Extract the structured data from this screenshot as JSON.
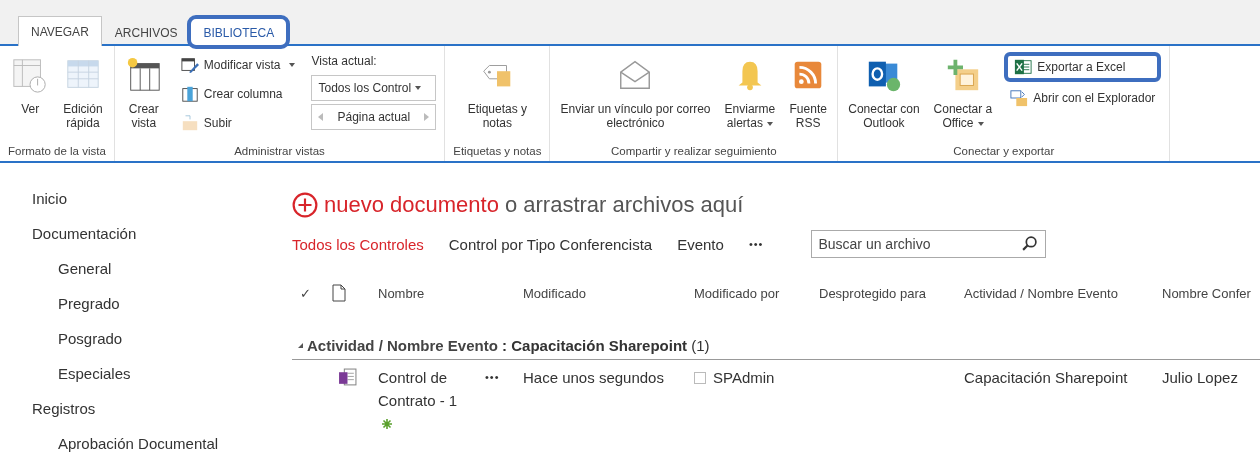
{
  "tabs": [
    {
      "label": "NAVEGAR",
      "selected": true,
      "highlighted": false
    },
    {
      "label": "ARCHIVOS",
      "selected": false,
      "highlighted": false
    },
    {
      "label": "BIBLIOTECA",
      "selected": false,
      "highlighted": true
    }
  ],
  "ribbon": [
    {
      "label": "Formato de la vista",
      "items": [
        {
          "kind": "large",
          "label": "Ver",
          "menu": false
        },
        {
          "kind": "large",
          "label": "Edición\nrápida",
          "menu": false
        }
      ]
    },
    {
      "label": "Administrar vistas",
      "items": [
        {
          "kind": "large",
          "label": "Crear\nvista",
          "menu": false
        },
        {
          "kind": "stack",
          "entries": [
            {
              "kind": "small",
              "label": "Modificar vista",
              "menu": true,
              "highlighted": false
            },
            {
              "kind": "small",
              "label": "Crear columna",
              "menu": false,
              "highlighted": false
            },
            {
              "kind": "small",
              "label": "Subir",
              "menu": false,
              "highlighted": false
            }
          ]
        },
        {
          "kind": "stack",
          "entries": [
            {
              "kind": "caption",
              "label": "Vista actual:"
            },
            {
              "kind": "select",
              "label": "Todos los Control"
            },
            {
              "kind": "pager",
              "label": "Página actual"
            }
          ]
        }
      ]
    },
    {
      "label": "Etiquetas y notas",
      "items": [
        {
          "kind": "large",
          "label": "Etiquetas y\nnotas",
          "menu": false
        }
      ]
    },
    {
      "label": "Compartir y realizar seguimiento",
      "items": [
        {
          "kind": "large",
          "label": "Enviar un vínculo por correo\nelectrónico",
          "menu": false
        },
        {
          "kind": "large",
          "label": "Enviarme\nalertas",
          "menu": true
        },
        {
          "kind": "large",
          "label": "Fuente\nRSS",
          "menu": false
        }
      ]
    },
    {
      "label": "Conectar y exportar",
      "items": [
        {
          "kind": "large",
          "label": "Conectar con\nOutlook",
          "menu": false
        },
        {
          "kind": "large",
          "label": "Conectar a\nOffice",
          "menu": true
        },
        {
          "kind": "stack",
          "entries": [
            {
              "kind": "small",
              "label": "Exportar a Excel",
              "menu": false,
              "highlighted": true
            },
            {
              "kind": "small",
              "label": "Abrir con el Explorador",
              "menu": false,
              "highlighted": false
            }
          ]
        }
      ]
    }
  ],
  "sidebar": [
    {
      "label": "Inicio"
    },
    {
      "label": "Documentación",
      "children": [
        {
          "label": "General"
        },
        {
          "label": "Pregrado"
        },
        {
          "label": "Posgrado"
        },
        {
          "label": "Especiales"
        }
      ]
    },
    {
      "label": "Registros",
      "children": [
        {
          "label": "Aprobación Documental"
        }
      ]
    }
  ],
  "new_document": {
    "action": "nuevo documento",
    "hint": "o arrastrar archivos aquí"
  },
  "views": [
    {
      "label": "Todos los Controles",
      "selected": true
    },
    {
      "label": "Control por Tipo Conferencista",
      "selected": false
    },
    {
      "label": "Evento",
      "selected": false
    }
  ],
  "more": "•••",
  "search": {
    "placeholder": "Buscar un archivo"
  },
  "table": {
    "check_mark": "✓",
    "columns": [
      "Nombre",
      "Modificado",
      "Modificado por",
      "Desprotegido para",
      "Actividad / Nombre Evento",
      "Nombre Confer"
    ],
    "group": {
      "field": "Actividad / Nombre Evento",
      "separator": ":",
      "value": "Capacitación Sharepoint",
      "count": "(1)",
      "expanded": true
    },
    "rows": [
      {
        "name": "Control de Contrato - 1",
        "new": true,
        "menu": "•••",
        "modified": "Hace unos segundos",
        "modified_by": "SPAdmin",
        "activity": "Capacitación Sharepoint",
        "column_6": "Julio Lopez"
      }
    ]
  }
}
